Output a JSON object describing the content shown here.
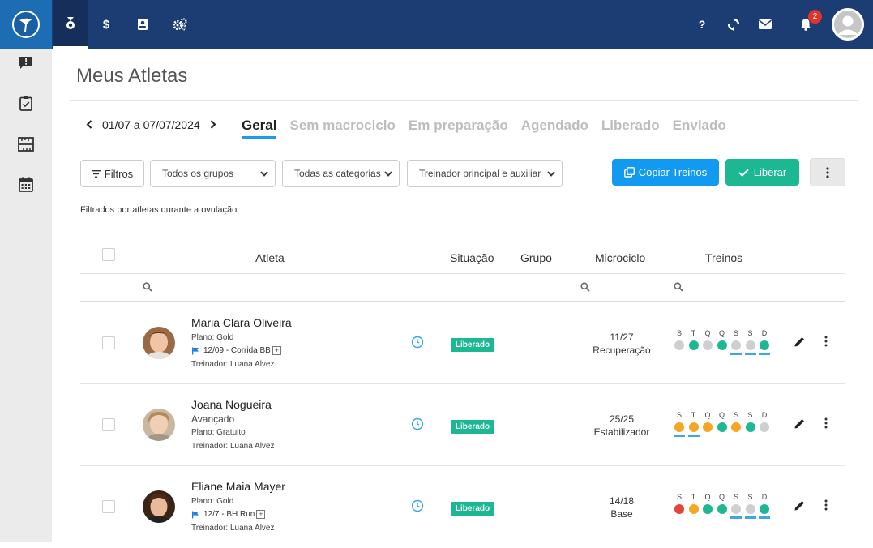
{
  "header": {
    "nav_icons": [
      "medal-icon",
      "dollar-icon",
      "contact-card-icon",
      "gears-icon"
    ],
    "right_icons": [
      "help-icon",
      "sync-icon",
      "mail-icon",
      "bell-icon"
    ],
    "help_glyph": "?",
    "dollar_glyph": "$",
    "notification_count": "2"
  },
  "sidebar": {
    "icons": [
      "alert-message-icon",
      "clipboard-check-icon",
      "ruler-icon",
      "calendar-icon"
    ]
  },
  "page": {
    "title": "Meus Atletas",
    "date_range": "01/07 a 07/07/2024",
    "tabs": [
      "Geral",
      "Sem macrociclo",
      "Em preparação",
      "Agendado",
      "Liberado",
      "Enviado"
    ],
    "active_tab": "Geral"
  },
  "toolbar": {
    "filter_label": "Filtros",
    "group_select": "Todos os grupos",
    "category_select": "Todas as categorias",
    "coach_select": "Treinador principal e auxiliar",
    "copy_label": "Copiar Treinos",
    "release_label": "Liberar"
  },
  "filter_note": "Filtrados por atletas durante a ovulação",
  "table": {
    "headers": {
      "athlete": "Atleta",
      "status": "Situação",
      "group": "Grupo",
      "microcycle": "Microciclo",
      "workouts": "Treinos"
    },
    "day_letters": [
      "S",
      "T",
      "Q",
      "Q",
      "S",
      "S",
      "D"
    ],
    "colors": {
      "grey": "#cfcfcf",
      "green": "#1cb894",
      "orange": "#f5a623",
      "red": "#e2453c"
    },
    "rows": [
      {
        "name": "Maria Clara Oliveira",
        "line1": "Plano: Gold",
        "flag": "12/09 - Corrida BB",
        "coach": "Treinador: Luana Alvez",
        "status": "Liberado",
        "micro_count": "11/27",
        "micro_name": "Recuperação",
        "dots": [
          "grey",
          "green",
          "grey",
          "green",
          "grey",
          "grey",
          "green"
        ],
        "underlined": [
          false,
          false,
          false,
          false,
          true,
          true,
          true
        ]
      },
      {
        "name": "Joana Nogueira",
        "level": "Avançado",
        "line1": "Plano: Gratuito",
        "coach": "Treinador: Luana Alvez",
        "status": "Liberado",
        "micro_count": "25/25",
        "micro_name": "Estabilizador",
        "dots": [
          "orange",
          "orange",
          "orange",
          "green",
          "orange",
          "green",
          "grey"
        ],
        "underlined": [
          true,
          true,
          false,
          false,
          false,
          false,
          false
        ]
      },
      {
        "name": "Eliane Maia Mayer",
        "line1": "Plano: Gold",
        "flag": "12/7 - BH Run",
        "coach": "Treinador: Luana Alvez",
        "status": "Liberado",
        "micro_count": "14/18",
        "micro_name": "Base",
        "dots": [
          "red",
          "orange",
          "green",
          "green",
          "grey",
          "grey",
          "green"
        ],
        "underlined": [
          false,
          false,
          false,
          false,
          true,
          true,
          true
        ]
      }
    ]
  }
}
